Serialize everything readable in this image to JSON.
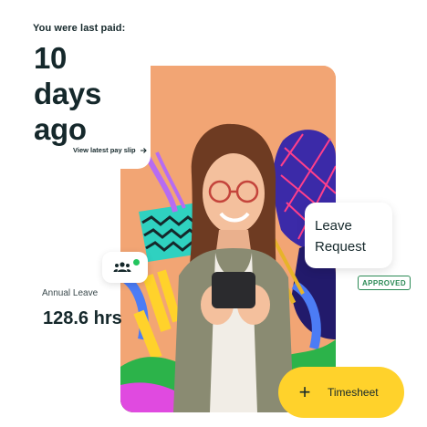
{
  "paid": {
    "label": "You were last paid:",
    "value": "10 days ago",
    "link": "View latest pay slip"
  },
  "leave": {
    "label": "Annual Leave",
    "value": "128.6 hrs"
  },
  "request": {
    "title": "Leave Request",
    "status": "APPROVED"
  },
  "timesheet": {
    "label": "Timesheet"
  },
  "icons": {
    "arrow": "arrow-right-icon",
    "team": "team-icon",
    "plus": "plus-icon"
  },
  "colors": {
    "accent_yellow": "#ffd22b",
    "approved_green": "#2b8a55",
    "online_dot": "#23c55e",
    "photo_background": "#f2a574"
  }
}
